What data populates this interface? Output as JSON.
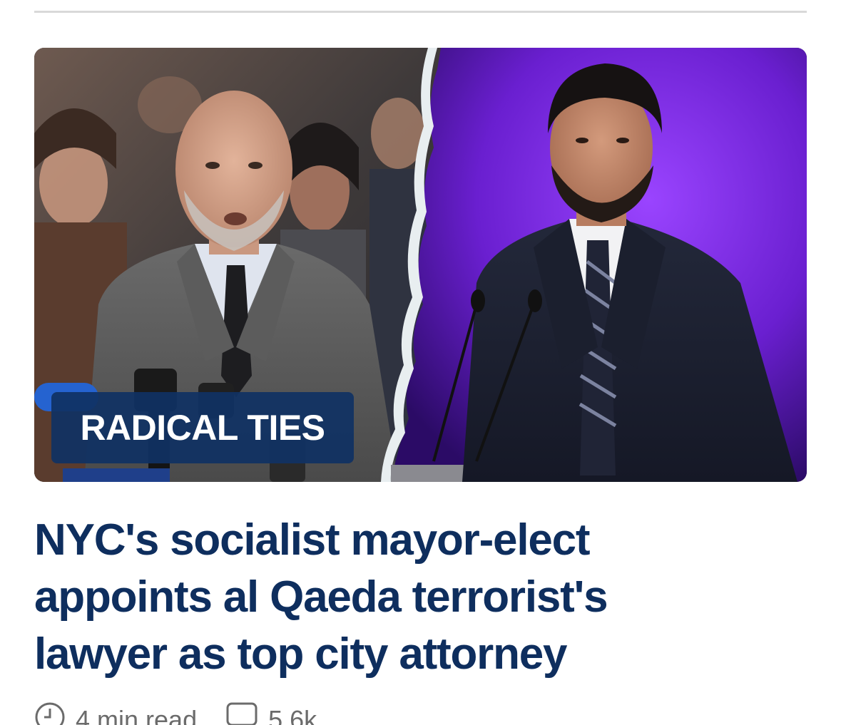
{
  "article": {
    "tag": "RADICAL TIES",
    "headline": "NYC's socialist mayor-elect appoints al Qaeda terrorist's lawyer as top city attorney",
    "hero_image": {
      "left_icon": "photo-bald-man-at-press-conference",
      "right_icon": "photo-bearded-man-at-podium",
      "right_background_color": "#6a1fd0"
    },
    "meta": {
      "read_time": "4 min read",
      "comments": "5.6k",
      "clock_icon": "clock-icon",
      "comment_icon": "comment-icon"
    }
  },
  "colors": {
    "headline": "#0e2e5e",
    "badge": "#103163"
  }
}
